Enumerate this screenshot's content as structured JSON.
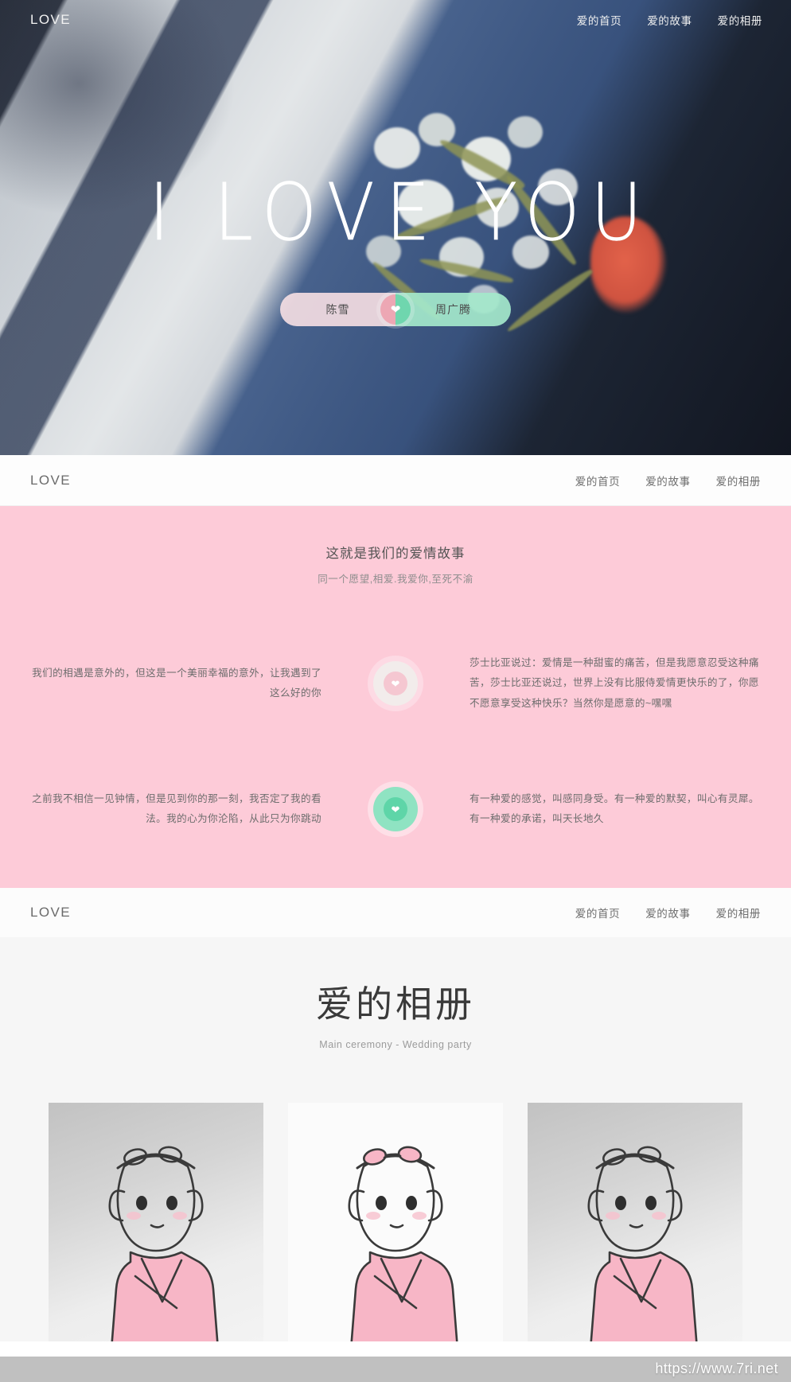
{
  "hero": {
    "nav": {
      "logo": "LOVE",
      "links": [
        "爱的首页",
        "爱的故事",
        "爱的相册"
      ]
    },
    "title": "I LOVE YOU",
    "badge": {
      "bride": "陈雪",
      "groom": "周广腾",
      "heart_icon": "heart-icon"
    }
  },
  "nav_white": {
    "logo": "LOVE",
    "links": [
      "爱的首页",
      "爱的故事",
      "爱的相册"
    ]
  },
  "story": {
    "heading": "这就是我们的爱情故事",
    "subheading": "同一个愿望,相爱.我爱你,至死不渝",
    "rows": [
      {
        "node_icon": "heart-icon",
        "left": "我们的相遇是意外的，但这是一个美丽幸福的意外，让我遇到了这么好的你",
        "right": "莎士比亚说过：爱情是一种甜蜜的痛苦，但是我愿意忍受这种痛苦，莎士比亚还说过，世界上没有比服侍爱情更快乐的了，你愿不愿意享受这种快乐？当然你是愿意的~嘿嘿"
      },
      {
        "node_icon": "heart-icon",
        "left": "之前我不相信一见钟情，但是见到你的那一刻，我否定了我的看法。我的心为你沦陷，从此只为你跳动",
        "right": "有一种爱的感觉，叫感同身受。有一种爱的默契，叫心有灵犀。有一种爱的承诺，叫天长地久"
      }
    ]
  },
  "nav_white2": {
    "logo": "LOVE",
    "links": [
      "爱的首页",
      "爱的故事",
      "爱的相册"
    ]
  },
  "album": {
    "heading": "爱的相册",
    "subheading": "Main ceremony - Wedding party",
    "photos": [
      {
        "alt": "girl-illustration-1",
        "style": "shade"
      },
      {
        "alt": "girl-illustration-2",
        "style": "light"
      },
      {
        "alt": "girl-illustration-3",
        "style": "shade"
      }
    ]
  },
  "watermark": "https://www.7ri.net",
  "colors": {
    "pink_section": "#fdcbd8",
    "badge_pink": "#fce2e6",
    "badge_mint": "#a4e8cb",
    "heart_pink": "#eda7b4",
    "heart_mint": "#6fd6ae",
    "album_bg": "#f6f6f6"
  }
}
